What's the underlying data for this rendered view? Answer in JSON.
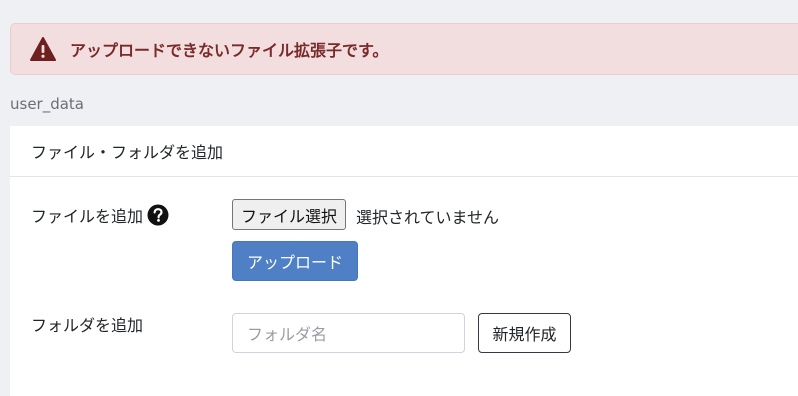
{
  "alert": {
    "icon": "warning-triangle-icon",
    "message": "アップロードできないファイル拡張子です。",
    "color": "#7a2a2a",
    "background": "#f2dede"
  },
  "breadcrumb": "user_data",
  "card": {
    "title": "ファイル・フォルダを追加",
    "file_row": {
      "label": "ファイルを追加",
      "help_icon": "question-circle-icon",
      "choose_button": "ファイル選択",
      "status": "選択されていません",
      "upload_button": "アップロード"
    },
    "folder_row": {
      "label": "フォルダを追加",
      "input_placeholder": "フォルダ名",
      "input_value": "",
      "create_button": "新規作成"
    }
  },
  "colors": {
    "primary": "#4f80c5",
    "page_bg": "#eff0f4"
  }
}
